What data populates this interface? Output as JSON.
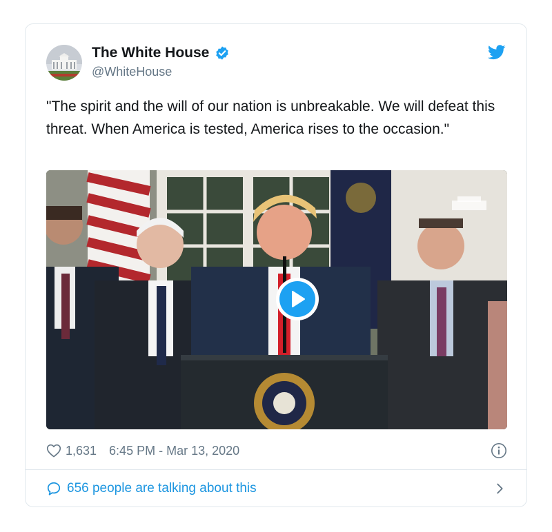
{
  "account": {
    "name": "The White House",
    "handle": "@WhiteHouse",
    "verified": true,
    "avatar_icon": "white-house-avatar"
  },
  "tweet": {
    "text": "\"The spirit and the will of our nation is unbreakable. We will defeat this threat. When America is tested, America rises to the occasion.\"",
    "media_type": "video",
    "video_thumbnail": "press-conference-at-podium-with-presidential-seal"
  },
  "stats": {
    "likes": "1,631",
    "timestamp": "6:45 PM - Mar 13, 2020"
  },
  "conversation": {
    "label": "656 people are talking about this"
  },
  "colors": {
    "brand_blue": "#1da1f2",
    "link_blue": "#1b95e0",
    "secondary_text": "#657786",
    "border": "#e1e8ed"
  }
}
